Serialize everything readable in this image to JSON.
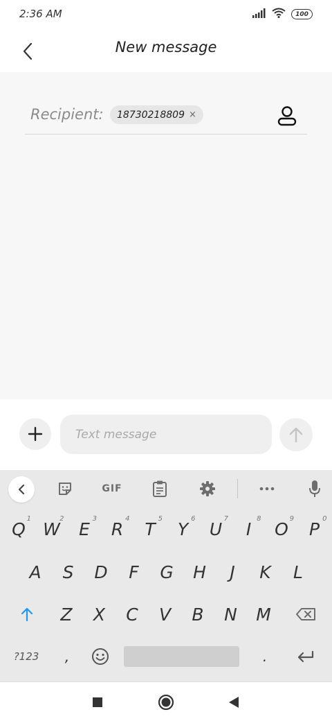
{
  "status_bar": {
    "time": "2:36 AM",
    "battery": "100"
  },
  "app_bar": {
    "title": "New message"
  },
  "recipient": {
    "label": "Recipient:",
    "chip": "18730218809",
    "chip_remove": "×"
  },
  "composer": {
    "placeholder": "Text message"
  },
  "keyboard": {
    "toolbar": {
      "gif": "GIF"
    },
    "row1": [
      {
        "k": "Q",
        "h": "1"
      },
      {
        "k": "W",
        "h": "2"
      },
      {
        "k": "E",
        "h": "3"
      },
      {
        "k": "R",
        "h": "4"
      },
      {
        "k": "T",
        "h": "5"
      },
      {
        "k": "Y",
        "h": "6"
      },
      {
        "k": "U",
        "h": "7"
      },
      {
        "k": "I",
        "h": "8"
      },
      {
        "k": "O",
        "h": "9"
      },
      {
        "k": "P",
        "h": "0"
      }
    ],
    "row2": [
      "A",
      "S",
      "D",
      "F",
      "G",
      "H",
      "J",
      "K",
      "L"
    ],
    "row3": [
      "Z",
      "X",
      "C",
      "V",
      "B",
      "N",
      "M"
    ],
    "symbols": "?123",
    "comma": ",",
    "period": "."
  },
  "colors": {
    "accent": "#2196f3",
    "keyboard_bg": "#e9e9e9",
    "content_bg": "#f7f7f7"
  }
}
